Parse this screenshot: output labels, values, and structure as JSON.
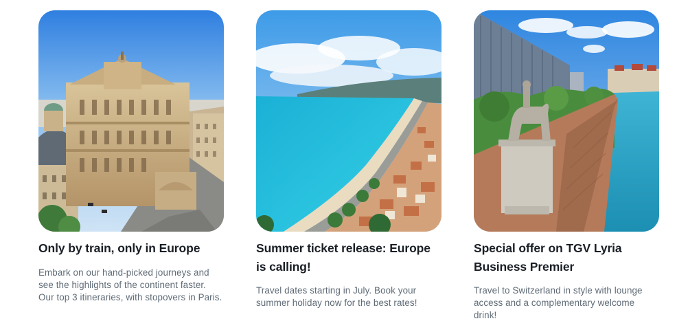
{
  "cards": [
    {
      "title": "Only by train, only in Europe",
      "text": "Embark on our hand-picked journeys and see the highlights of the continent faster. Our top 3 itineraries, with stopovers in Paris.",
      "image_subject": "paris-opera-house"
    },
    {
      "title": "Summer ticket release: Europe is calling!",
      "text": "Travel dates starting in July. Book your summer holiday now for the best rates!",
      "image_subject": "nice-coastline-beach"
    },
    {
      "title": "Special offer on TGV Lyria Business Premier",
      "text": "Travel to Switzerland in style with lounge access and a complementary welcome drink!",
      "image_subject": "geneva-lakeside-statue"
    }
  ],
  "colors": {
    "title": "#1a1f26",
    "body_text": "#5f6b76"
  }
}
